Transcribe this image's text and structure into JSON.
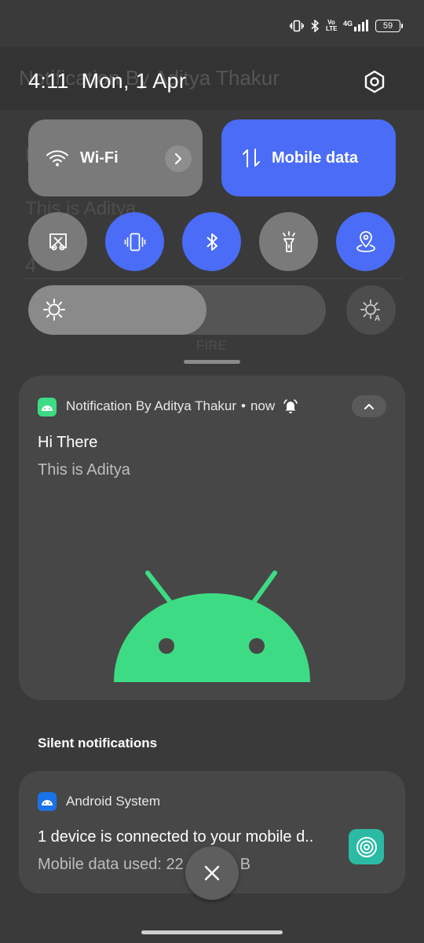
{
  "background_app": {
    "title": "Notification By Aditya Thakur",
    "line1": "Hi There",
    "line2": "This is Aditya",
    "line3": "4",
    "button": "FIRE"
  },
  "status_bar": {
    "icons": [
      "vibrate-icon",
      "bluetooth-icon",
      "volte-icon",
      "signal-4g-icon"
    ],
    "volte_text": "Vo LTE",
    "network_text": "4G",
    "battery": "59"
  },
  "header": {
    "time": "4:11",
    "date": "Mon, 1 Apr"
  },
  "quick_settings": {
    "wifi": {
      "label": "Wi-Fi",
      "active": false
    },
    "mobile_data": {
      "label": "Mobile data",
      "active": true
    },
    "toggles": [
      {
        "icon": "screenshot-icon",
        "active": false
      },
      {
        "icon": "vibrate-icon",
        "active": true
      },
      {
        "icon": "bluetooth-icon",
        "active": true
      },
      {
        "icon": "flashlight-icon",
        "active": false
      },
      {
        "icon": "location-icon",
        "active": true
      }
    ],
    "brightness_level": 0.6
  },
  "notification": {
    "app": "Notification By Aditya Thakur",
    "separator": "•",
    "time": "now",
    "title": "Hi There",
    "text": "This is Aditya"
  },
  "silent_section": {
    "label": "Silent notifications"
  },
  "system_notification": {
    "app": "Android System",
    "title": "1 device is connected to your mobile d..",
    "text": "Mobile data used: 22",
    "text_tail": "B"
  },
  "colors": {
    "accent": "#4a6cf7",
    "android_green": "#3ddc84",
    "hotspot_teal": "#2bbba4"
  }
}
